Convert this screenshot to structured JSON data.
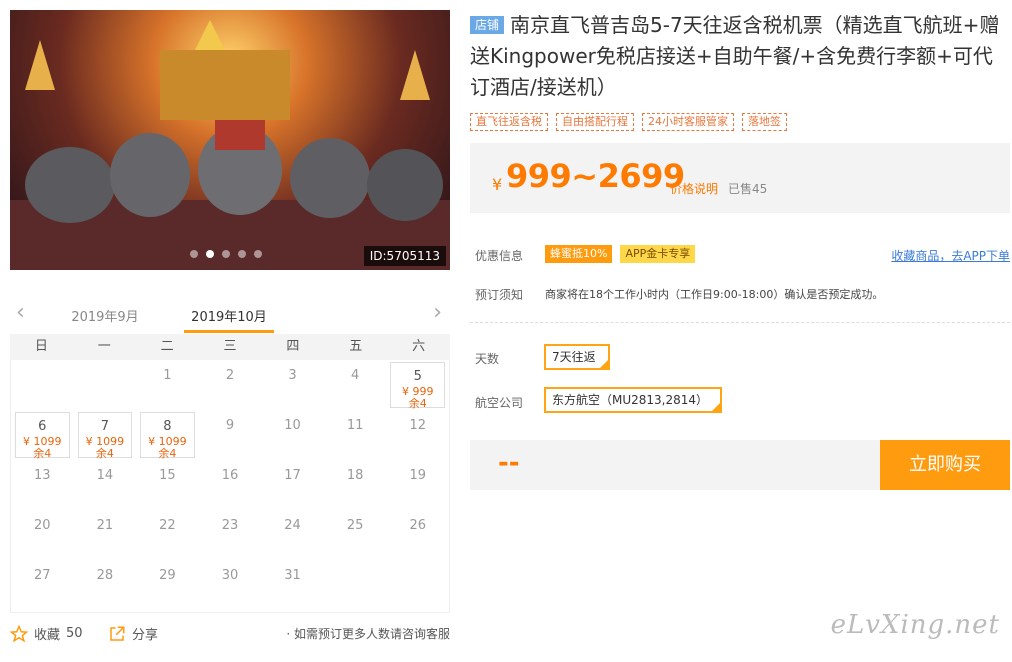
{
  "hero": {
    "image_id": "ID:5705113"
  },
  "calendar": {
    "prev_month": "2019年9月",
    "current_month": "2019年10月",
    "weekdays": [
      "日",
      "一",
      "二",
      "三",
      "四",
      "五",
      "六"
    ],
    "cells": [
      {
        "day": ""
      },
      {
        "day": ""
      },
      {
        "day": "1"
      },
      {
        "day": "2"
      },
      {
        "day": "3"
      },
      {
        "day": "4"
      },
      {
        "day": "5",
        "price": "¥ 999",
        "stock": "余4"
      },
      {
        "day": "6",
        "price": "¥ 1099",
        "stock": "余4"
      },
      {
        "day": "7",
        "price": "¥ 1099",
        "stock": "余4"
      },
      {
        "day": "8",
        "price": "¥ 1099",
        "stock": "余4"
      },
      {
        "day": "9"
      },
      {
        "day": "10"
      },
      {
        "day": "11"
      },
      {
        "day": "12"
      },
      {
        "day": "13"
      },
      {
        "day": "14"
      },
      {
        "day": "15"
      },
      {
        "day": "16"
      },
      {
        "day": "17"
      },
      {
        "day": "18"
      },
      {
        "day": "19"
      },
      {
        "day": "20"
      },
      {
        "day": "21"
      },
      {
        "day": "22"
      },
      {
        "day": "23"
      },
      {
        "day": "24"
      },
      {
        "day": "25"
      },
      {
        "day": "26"
      },
      {
        "day": "27"
      },
      {
        "day": "28"
      },
      {
        "day": "29"
      },
      {
        "day": "30"
      },
      {
        "day": "31"
      },
      {
        "day": ""
      },
      {
        "day": ""
      }
    ]
  },
  "actions": {
    "favorite_label": "收藏",
    "favorite_count": "50",
    "share_label": "分享",
    "group_note": "· 如需预订更多人数请咨询客服"
  },
  "product": {
    "shop_badge": "店铺",
    "title": "南京直飞普吉岛5-7天往返含税机票（精选直飞航班+赠送Kingpower免税店接送+自助午餐/+含免费行李额+可代订酒店/接送机）",
    "tags": [
      "直飞往返含税",
      "自由搭配行程",
      "24小时客服管家",
      "落地签"
    ],
    "currency": "¥",
    "price_range": "999~2699",
    "price_explain": "价格说明",
    "sold": "已售45"
  },
  "info": {
    "promo_label": "优惠信息",
    "promo_tags": [
      "蜂蜜抵10%",
      "APP金卡专享"
    ],
    "app_link": "收藏商品，去APP下单",
    "notice_label": "预订须知",
    "notice_text": "商家将在18个工作小时内（工作日9:00-18:00）确认是否预定成功。"
  },
  "options": {
    "days_label": "天数",
    "days_value": "7天往返",
    "airline_label": "航空公司",
    "airline_value": "东方航空（MU2813,2814）"
  },
  "buy": {
    "total": "--",
    "button": "立即购买"
  },
  "watermark": "eLvXing.net"
}
